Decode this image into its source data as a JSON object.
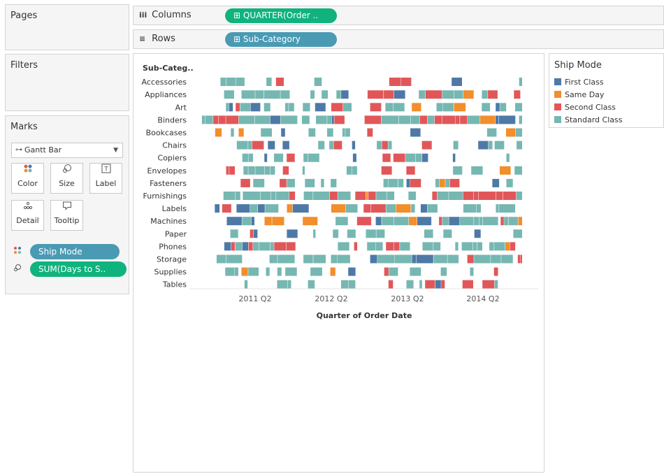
{
  "pages": {
    "title": "Pages"
  },
  "filters": {
    "title": "Filters"
  },
  "marks": {
    "title": "Marks",
    "mark_type": "Gantt Bar",
    "buttons": {
      "color": "Color",
      "size": "Size",
      "label": "Label",
      "detail": "Detail",
      "tooltip": "Tooltip"
    },
    "pills": {
      "color_field": "Ship Mode",
      "size_field": "SUM(Days to S.."
    }
  },
  "shelves": {
    "columns_label": "Columns",
    "columns_pill": "⊞ QUARTER(Order ..",
    "rows_label": "Rows",
    "rows_pill": "⊞ Sub-Category"
  },
  "legend": {
    "title": "Ship Mode",
    "items": [
      {
        "label": "First Class",
        "color": "#4e79a7"
      },
      {
        "label": "Same Day",
        "color": "#f28e2b"
      },
      {
        "label": "Second Class",
        "color": "#e15759"
      },
      {
        "label": "Standard Class",
        "color": "#76b7b2"
      }
    ]
  },
  "colors": {
    "columns_pill": "#10b27e",
    "rows_pill": "#4a9ab4",
    "pill_blue": "#4a9ab4",
    "pill_green": "#10b27e"
  },
  "chart_data": {
    "type": "gantt",
    "row_header": "Sub-Categ..",
    "xlabel": "Quarter of Order Date",
    "x_ticks": [
      "2011 Q2",
      "2012 Q2",
      "2013 Q2",
      "2014 Q2"
    ],
    "categories": [
      "Accessories",
      "Appliances",
      "Art",
      "Binders",
      "Bookcases",
      "Chairs",
      "Copiers",
      "Envelopes",
      "Fasteners",
      "Furnishings",
      "Labels",
      "Machines",
      "Paper",
      "Phones",
      "Storage",
      "Supplies",
      "Tables"
    ],
    "color_field": "Ship Mode"
  }
}
